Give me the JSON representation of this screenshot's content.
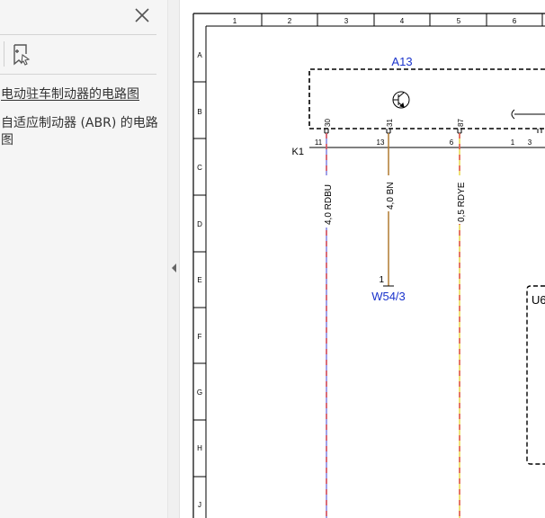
{
  "sidebar": {
    "items": [
      {
        "label": "电动驻车制动器的电路图",
        "active": true
      },
      {
        "label": "自适应制动器 (ABR) 的电路图",
        "active": false
      }
    ]
  },
  "diagram": {
    "columns": [
      "1",
      "2",
      "3",
      "4",
      "5",
      "6"
    ],
    "rows": [
      "A",
      "B",
      "C",
      "D",
      "E",
      "F",
      "G",
      "H",
      "J"
    ],
    "module_label": "A13",
    "connector_label": "K1",
    "connector_pins": [
      "11",
      "13",
      "6",
      "1",
      "3"
    ],
    "module_pins": [
      "30",
      "31",
      "87"
    ],
    "wires": [
      "4,0 RDBU",
      "4,0 BN",
      "0,5 RDYE"
    ],
    "ground_pin": "1",
    "ground_label": "W54/3",
    "module2_label": "U6",
    "colors": {
      "link_blue": "#1a33cc",
      "wire_red": "#e05050",
      "wire_blue": "#8080e0",
      "wire_brown": "#b07a30",
      "wire_yellow": "#e8d84a"
    }
  }
}
